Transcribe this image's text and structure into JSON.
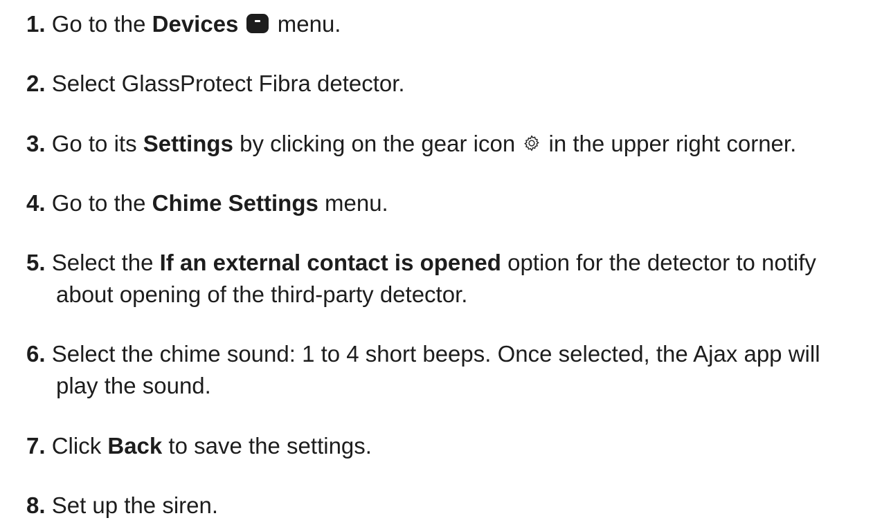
{
  "steps": [
    {
      "num": "1.",
      "pre": "Go to the ",
      "bold": "Devices",
      "post": " menu.",
      "icon": "devices-icon"
    },
    {
      "num": "2.",
      "text": "Select GlassProtect Fibra detector."
    },
    {
      "num": "3.",
      "pre": "Go to its ",
      "bold": "Settings",
      "mid": " by clicking on the gear icon ",
      "post": " in the upper right corner.",
      "icon": "gear-icon"
    },
    {
      "num": "4.",
      "pre": "Go to the ",
      "bold": "Chime Settings",
      "post": " menu."
    },
    {
      "num": "5.",
      "pre": "Select the ",
      "bold": "If an external contact is opened",
      "post": " option for the detector to notify",
      "cont": "about opening of the third-party detector."
    },
    {
      "num": "6.",
      "text": "Select the chime sound: 1 to 4 short beeps. Once selected, the Ajax app will",
      "cont": "play the sound."
    },
    {
      "num": "7.",
      "pre": "Click ",
      "bold": "Back",
      "post": " to save the settings."
    },
    {
      "num": "8.",
      "text": "Set up the siren."
    }
  ]
}
